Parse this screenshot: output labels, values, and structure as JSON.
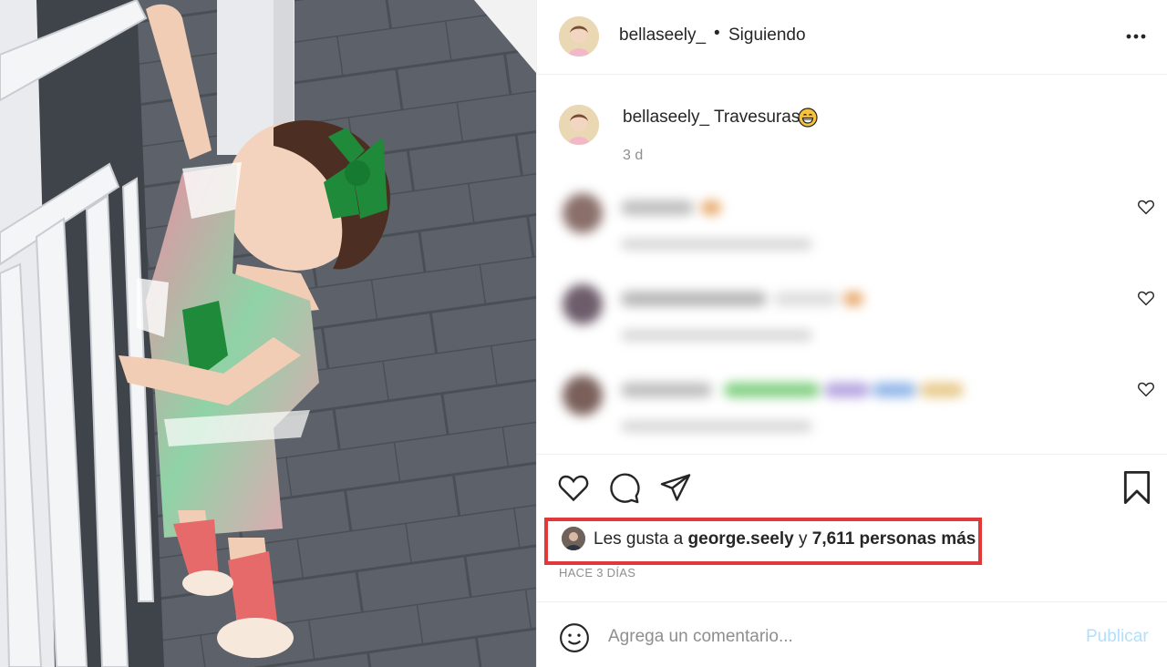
{
  "header": {
    "username": "bellaseely_",
    "separator": "•",
    "follow_status": "Siguiendo"
  },
  "caption": {
    "username": "bellaseely_",
    "text": "Travesuras",
    "emoji": "grinning-face",
    "time": "3 d"
  },
  "comments": [
    {
      "blurred": true,
      "accent": "#e8a86a"
    },
    {
      "blurred": true,
      "accent": "#e8a86a"
    },
    {
      "blurred": true,
      "accent": "#6fc46f"
    }
  ],
  "likes": {
    "prefix": "Les gusta a",
    "user": "george.seely",
    "connector": "y",
    "count_text": "7,611 personas más"
  },
  "post_time": "HACE 3 DÍAS",
  "comment_box": {
    "placeholder": "Agrega un comentario...",
    "publish_label": "Publicar"
  },
  "colors": {
    "highlight_box": "#e0393b",
    "publish_disabled": "#b2dffc",
    "muted_text": "#8e8e8e"
  }
}
